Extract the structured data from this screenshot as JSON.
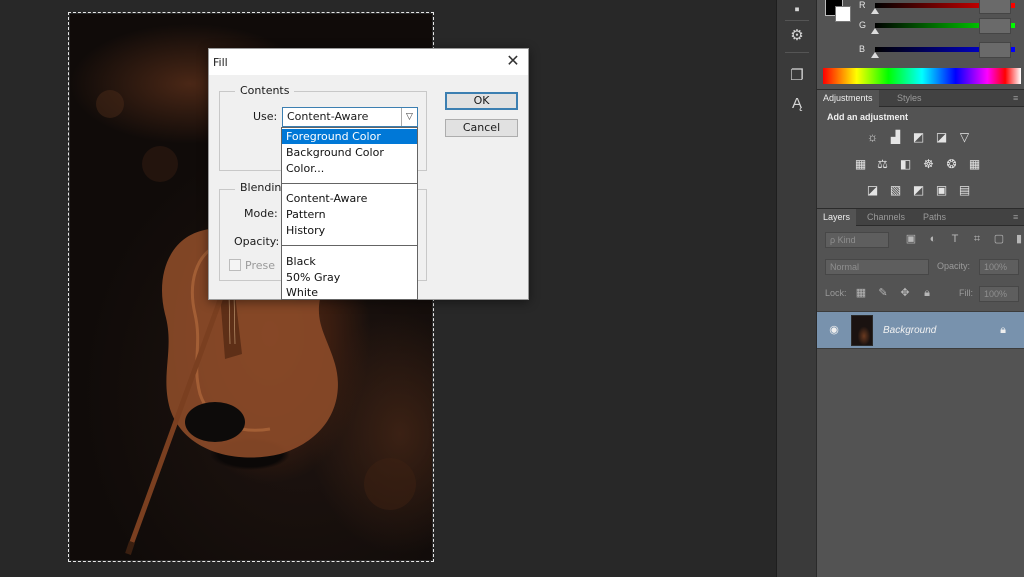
{
  "dialog": {
    "title": "Fill",
    "contents_legend": "Contents",
    "use_label": "Use:",
    "use_value": "Content-Aware",
    "blending_legend": "Blendin",
    "mode_label": "Mode:",
    "opacity_label": "Opacity:",
    "preserve_label": "Prese",
    "ok_label": "OK",
    "cancel_label": "Cancel"
  },
  "dropdown": {
    "group1": [
      "Foreground Color",
      "Background Color",
      "Color..."
    ],
    "group2": [
      "Content-Aware",
      "Pattern",
      "History"
    ],
    "group3": [
      "Black",
      "50% Gray",
      "White"
    ],
    "selected": "Foreground Color"
  },
  "color_panel": {
    "r_label": "R",
    "g_label": "G",
    "b_label": "B"
  },
  "adjustments": {
    "tab_active": "Adjustments",
    "tab_other": "Styles",
    "title": "Add an adjustment"
  },
  "layers": {
    "tab_active": "Layers",
    "tab_channels": "Channels",
    "tab_paths": "Paths",
    "kind_label": "ρ Kind",
    "blend_mode": "Normal",
    "opacity_label": "Opacity:",
    "opacity_value": "100%",
    "lock_label": "Lock:",
    "fill_label": "Fill:",
    "fill_value": "100%",
    "layer_name": "Background"
  },
  "colors": {
    "selection": "#0078d7",
    "layer_highlight": "#7892ad"
  }
}
